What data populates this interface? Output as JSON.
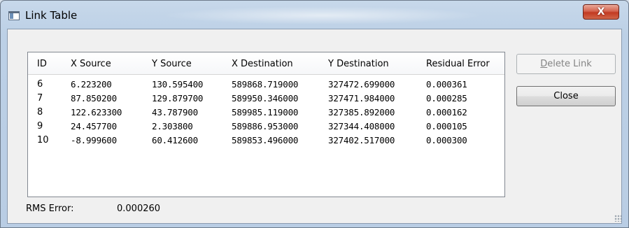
{
  "window": {
    "title": "Link Table",
    "close_glyph": "X"
  },
  "table": {
    "columns": [
      "ID",
      "X Source",
      "Y Source",
      "X Destination",
      "Y Destination",
      "Residual Error"
    ],
    "rows": [
      [
        "6",
        "6.223200",
        "130.595400",
        "589868.719000",
        "327472.699000",
        "0.000361"
      ],
      [
        "7",
        "87.850200",
        "129.879700",
        "589950.346000",
        "327471.984000",
        "0.000285"
      ],
      [
        "8",
        "122.623300",
        "43.787900",
        "589985.119000",
        "327385.892000",
        "0.000162"
      ],
      [
        "9",
        "24.457700",
        "2.303800",
        "589886.953000",
        "327344.408000",
        "0.000105"
      ],
      [
        "10",
        "-8.999600",
        "60.412600",
        "589853.496000",
        "327402.517000",
        "0.000300"
      ]
    ]
  },
  "buttons": {
    "delete_link": {
      "underline": "D",
      "rest": "elete Link",
      "enabled": false
    },
    "close": "Close"
  },
  "status": {
    "label": "RMS Error:",
    "value": "0.000260"
  },
  "icons": {
    "app": "window-icon",
    "close": "close-icon",
    "grip": "resize-grip-icon"
  }
}
